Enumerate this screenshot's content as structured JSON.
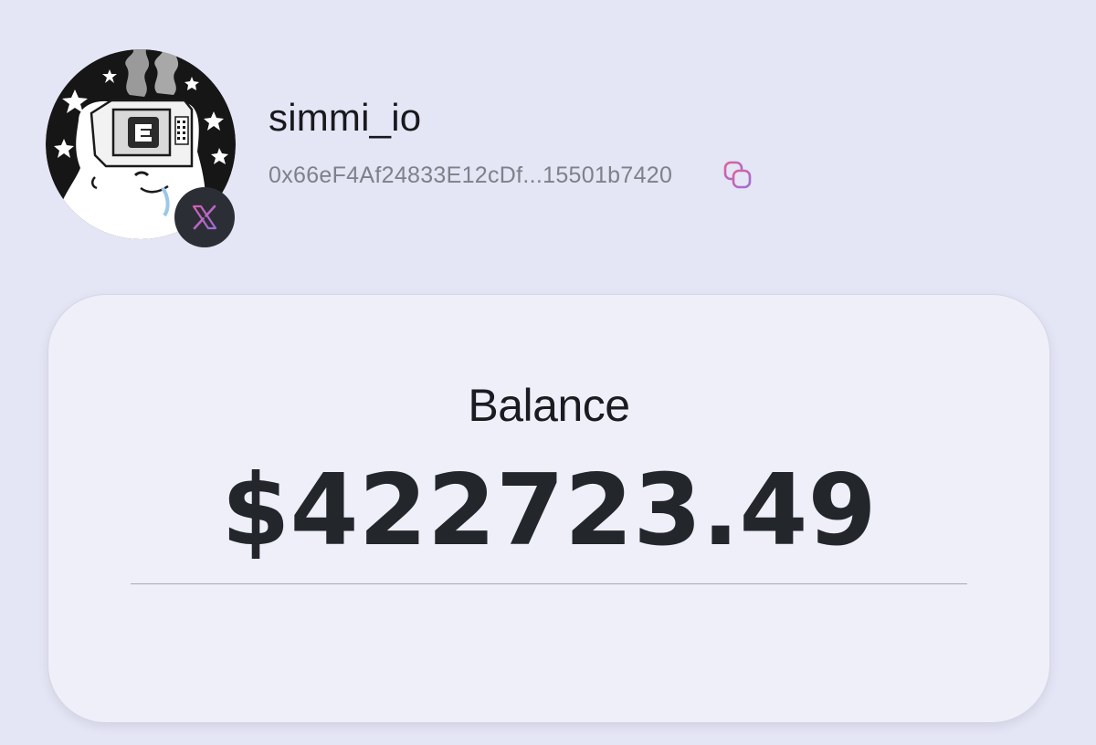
{
  "profile": {
    "username": "simmi_io",
    "address": "0x66eF4Af24833E12cDf...15501b7420",
    "avatar_icon": "cartoon-avatar-icon",
    "badge_icon": "x-logo-icon",
    "copy_icon": "copy-icon"
  },
  "balance": {
    "label": "Balance",
    "value": "$422723.49"
  },
  "colors": {
    "background": "#e4e5f5",
    "card": "#efeffa",
    "text_primary": "#17191d",
    "text_secondary": "#7f8089",
    "badge": "#2c2e35",
    "accent_pink": "#d45fb2",
    "accent_purple": "#9a6fd8"
  }
}
